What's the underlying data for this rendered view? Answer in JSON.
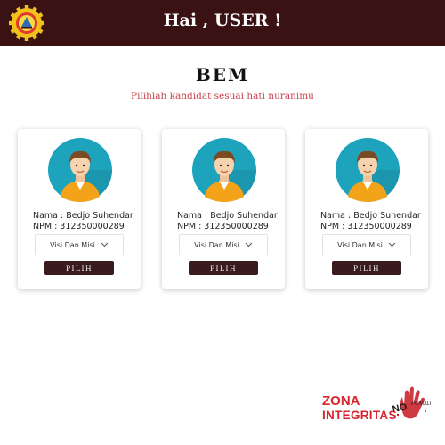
{
  "header": {
    "greeting": "Hai , USER !",
    "logo_icon": "university-emblem-icon",
    "background": "#3a1214"
  },
  "page": {
    "title": "BEM",
    "subtitle": "Pilihlah kandidat sesuai hati nuranimu",
    "accent": "#c8414a"
  },
  "candidates": [
    {
      "name_label": "Nama",
      "name": "Bedjo Suhendar",
      "npm_label": "NPM",
      "npm": "312350000289",
      "visi_label": "Visi Dan Misi",
      "pilih_label": "PILIH"
    },
    {
      "name_label": "Nama",
      "name": "Bedjo Suhendar",
      "npm_label": "NPM",
      "npm": "312350000289",
      "visi_label": "Visi Dan Misi",
      "pilih_label": "PILIH"
    },
    {
      "name_label": "Nama",
      "name": "Bedjo Suhendar",
      "npm_label": "NPM",
      "npm": "312350000289",
      "visi_label": "Visi Dan Misi",
      "pilih_label": "PILIH"
    }
  ],
  "footer_badge": {
    "line1": "ZONA",
    "line2": "INTEGRITAS",
    "stamp": "NO PUNGLI",
    "color": "#d7262d"
  }
}
